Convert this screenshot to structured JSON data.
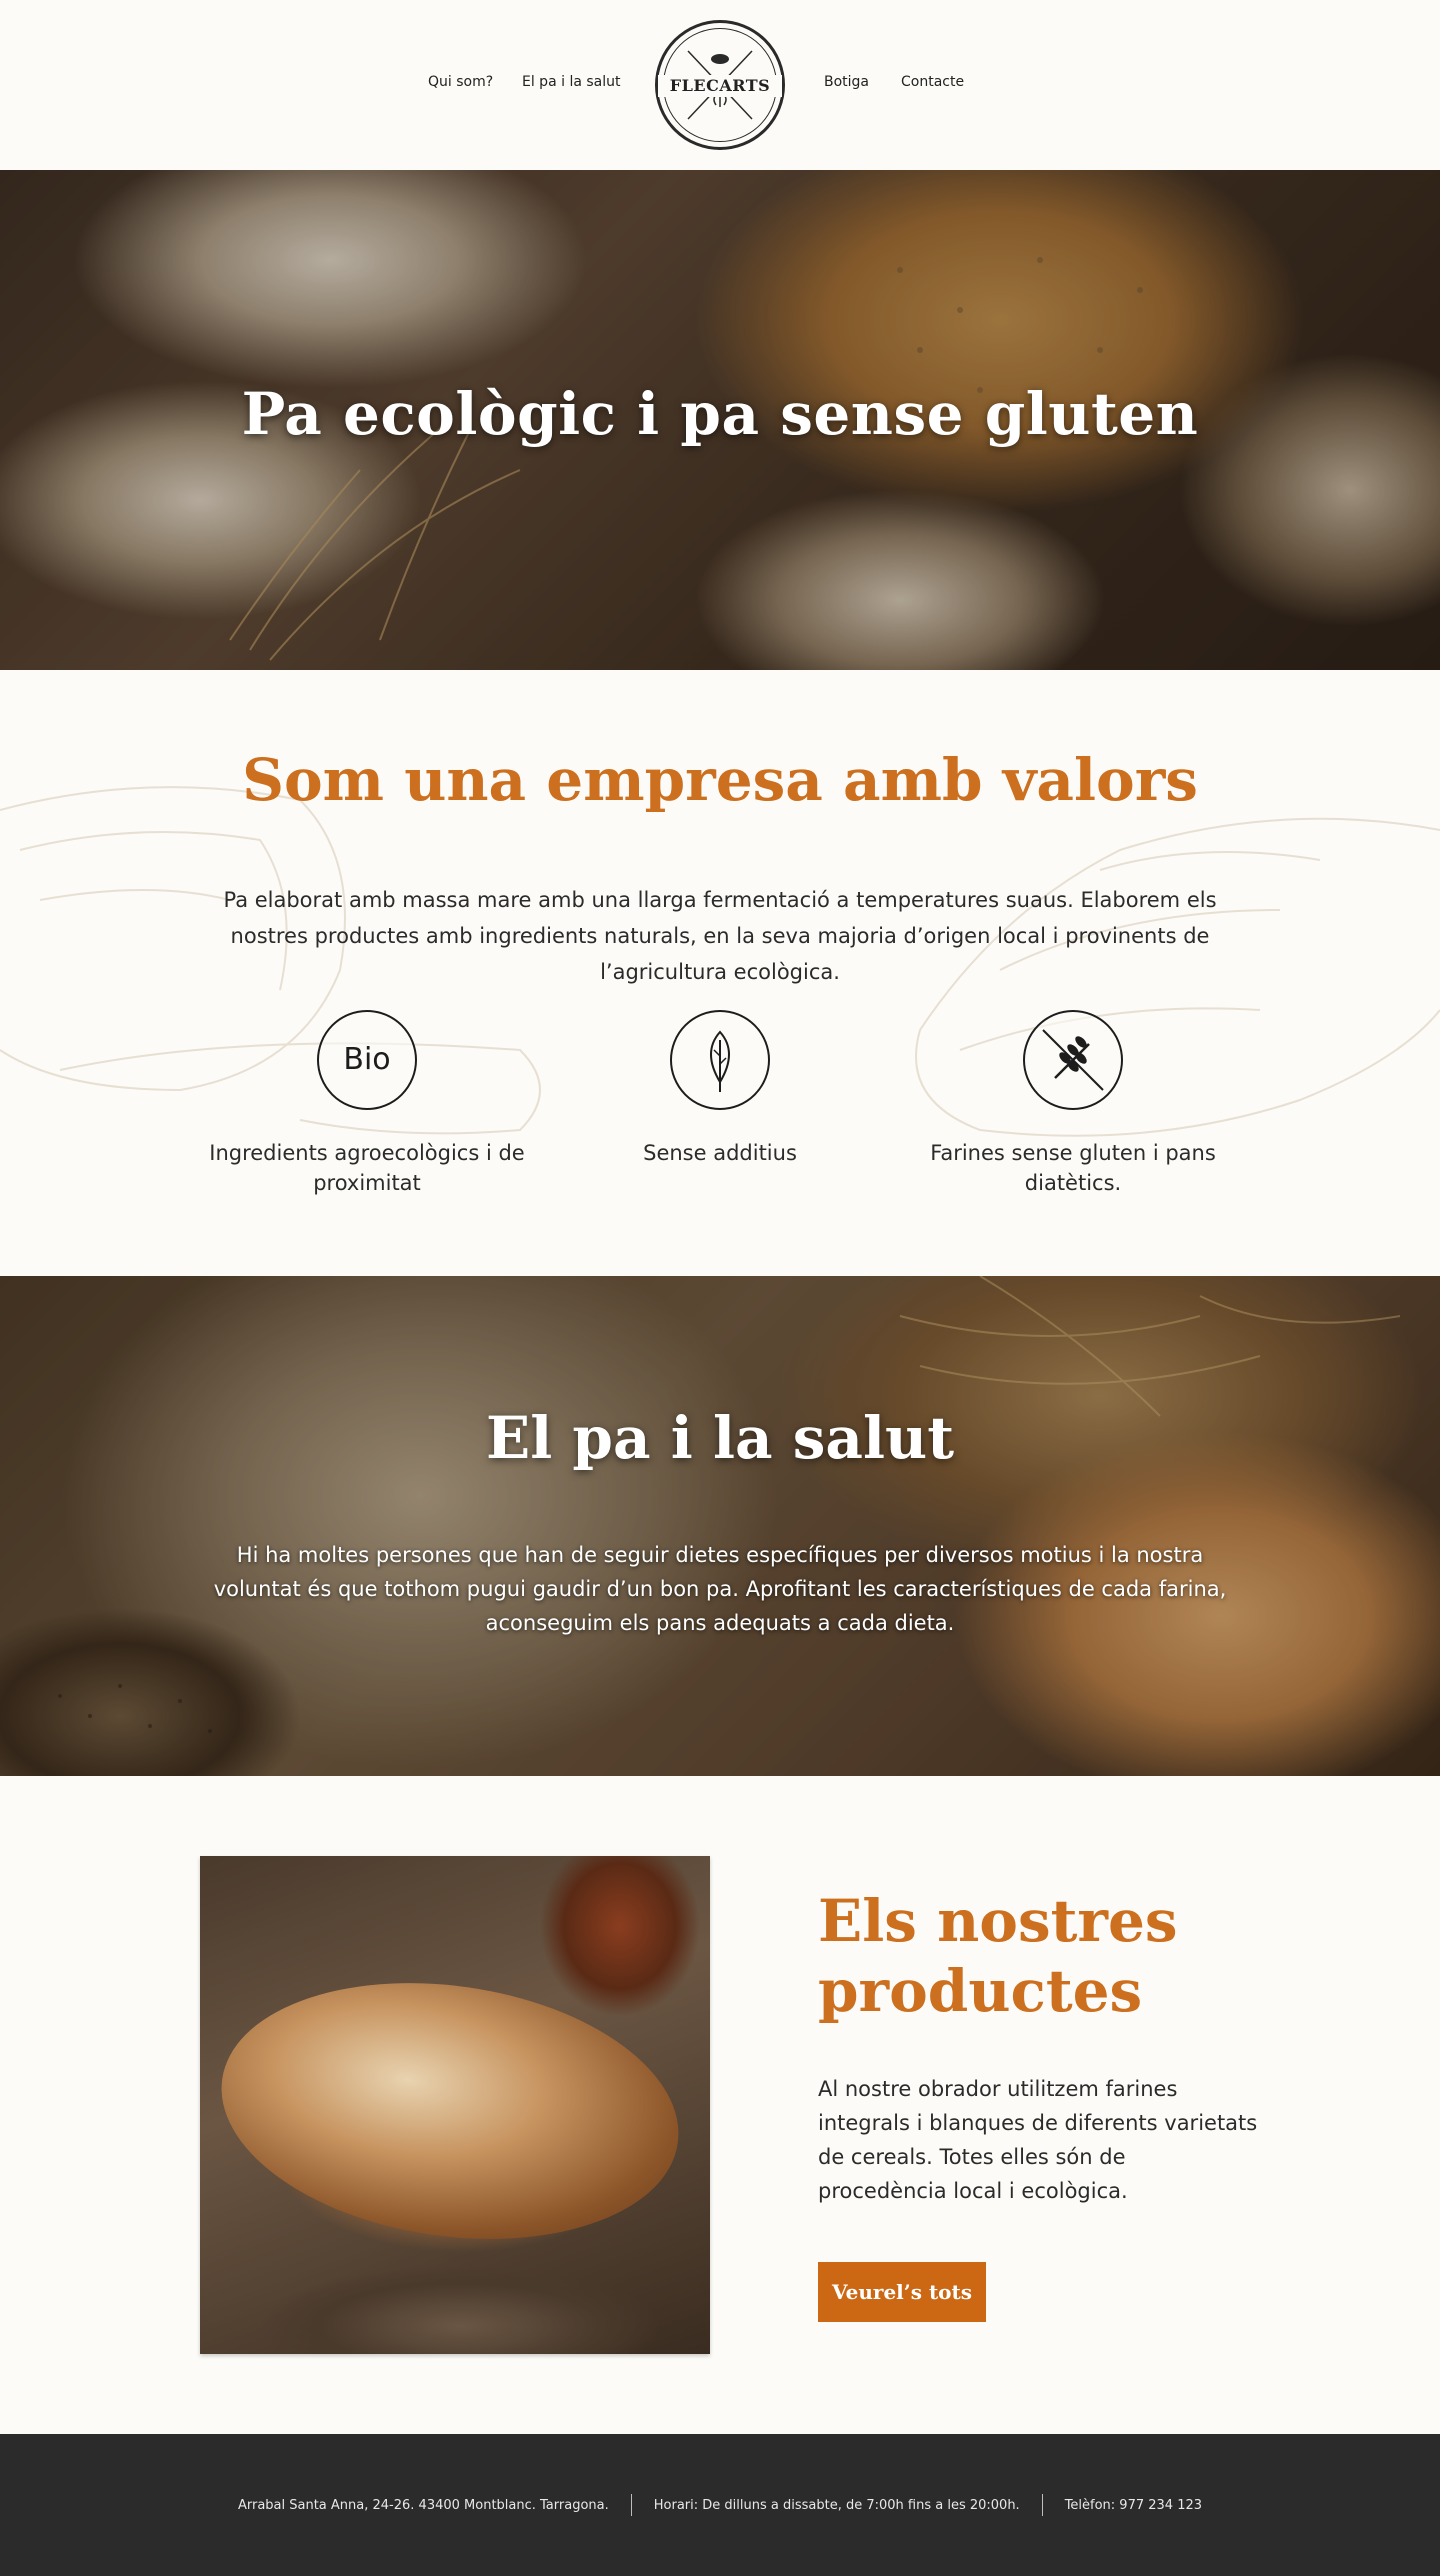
{
  "header": {
    "nav_left": [
      "Qui som?",
      "El pa i la salut"
    ],
    "nav_right": [
      "Botiga",
      "Contacte"
    ],
    "logo_text": "FLECARTS"
  },
  "hero": {
    "title": "Pa ecològic i pa sense gluten"
  },
  "values": {
    "title": "Som una empresa amb valors",
    "text": "Pa elaborat amb massa mare amb una llarga fermentació a temperatures suaus. Elaborem els nostres productes amb ingredients naturals, en la seva majoria d’origen local i provinents de l’agricultura ecològica.",
    "features": [
      {
        "icon": "bio-icon",
        "icon_text": "Bio",
        "label": "Ingredients agroecològics i de proximitat"
      },
      {
        "icon": "leaf-icon",
        "label": "Sense additius"
      },
      {
        "icon": "no-gluten-icon",
        "label": "Farines sense gluten i pans diatètics."
      }
    ]
  },
  "health": {
    "title": "El pa i la salut",
    "text": "Hi ha moltes persones que han de seguir dietes específiques per diversos motius i la nostra voluntat és que tothom pugui gaudir d’un bon pa. Aprofitant les característiques de cada farina, aconseguim els pans adequats a cada dieta."
  },
  "products": {
    "title": "Els nostres productes",
    "text": "Al nostre obrador utilitzem farines integrals i blanques de diferents varietats de cereals. Totes elles són de procedència local i ecològica.",
    "button_label": "Veurel’s tots"
  },
  "footer": {
    "address": "Arrabal Santa Anna, 24-26. 43400 Montblanc. Tarragona.",
    "hours": "Horari: De dilluns a dissabte, de 7:00h fins a les 20:00h.",
    "phone": "Telèfon: 977 234 123"
  },
  "colors": {
    "accent": "#cc6f1e",
    "button": "#cc6814",
    "footer_bg": "#2b2b2b",
    "page_bg": "#fcfbf7"
  }
}
